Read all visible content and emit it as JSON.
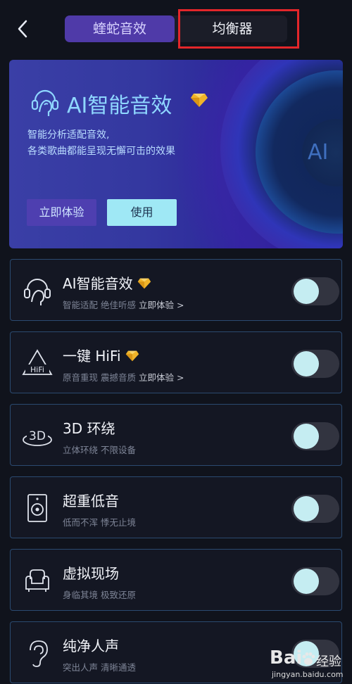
{
  "topbar": {
    "back_icon": "chevron-left-icon",
    "tabs": [
      {
        "label": "蝰蛇音效",
        "selected": true
      },
      {
        "label": "均衡器",
        "selected": false
      }
    ],
    "accent_tab_color": "#4f3aa8"
  },
  "banner": {
    "title": "AI智能音效",
    "desc_line1": "智能分析适配音效,",
    "desc_line2": "各类歌曲都能呈现无懈可击的效果",
    "orb_text": "AI",
    "try_label": "立即体验",
    "use_label": "使用"
  },
  "features": [
    {
      "title": "AI智能音效",
      "premium": true,
      "sub": "智能适配 绝佳听感",
      "link": "立即体验 >",
      "icon": "ai-head-icon",
      "enabled": false
    },
    {
      "title": "一键 HiFi",
      "premium": true,
      "sub": "原音重现 震撼音质",
      "link": "立即体验 >",
      "icon": "hifi-icon",
      "enabled": false
    },
    {
      "title": "3D 环绕",
      "premium": false,
      "sub": "立体环绕 不限设备",
      "link": "",
      "icon": "3d-surround-icon",
      "enabled": false
    },
    {
      "title": "超重低音",
      "premium": false,
      "sub": "低而不浑 悸无止境",
      "link": "",
      "icon": "speaker-icon",
      "enabled": false
    },
    {
      "title": "虚拟现场",
      "premium": false,
      "sub": "身临其境 极致还原",
      "link": "",
      "icon": "sofa-icon",
      "enabled": false
    },
    {
      "title": "纯净人声",
      "premium": false,
      "sub": "突出人声 清晰通透",
      "link": "",
      "icon": "ear-icon",
      "enabled": false
    }
  ],
  "watermark": {
    "brand_a": "Bai",
    "brand_b": "经验",
    "url": "jingyan.baidu.com"
  },
  "colors": {
    "background": "#10131c",
    "card_border": "#2b4a70",
    "toggle_knob": "#c5edf2",
    "use_button": "#9fe8f5",
    "gem": "#f0b429"
  }
}
